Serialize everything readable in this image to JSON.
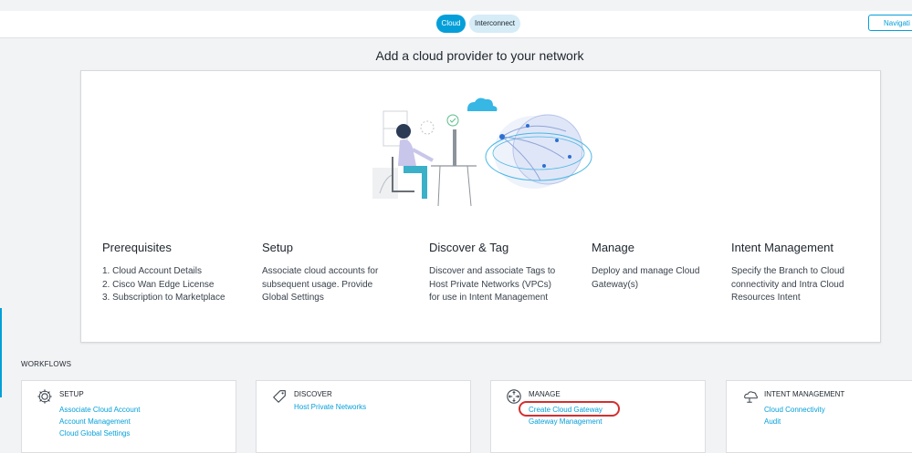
{
  "topbar": {
    "tabs": [
      {
        "label": "Cloud",
        "active": true
      },
      {
        "label": "Interconnect",
        "active": false
      }
    ],
    "nav_button_label": "Navigati"
  },
  "hero": {
    "title": "Add a cloud provider to your network",
    "columns": [
      {
        "title": "Prerequisites",
        "lines": [
          "1. Cloud Account Details",
          "2. Cisco Wan Edge License",
          "3. Subscription to Marketplace"
        ]
      },
      {
        "title": "Setup",
        "lines": [
          "Associate cloud accounts for",
          "subsequent usage. Provide",
          "Global Settings"
        ]
      },
      {
        "title": "Discover & Tag",
        "lines": [
          "Discover and associate Tags to",
          "Host Private Networks (VPCs)",
          "for use in Intent Management"
        ]
      },
      {
        "title": "Manage",
        "lines": [
          "Deploy and manage Cloud",
          "Gateway(s)"
        ]
      },
      {
        "title": "Intent Management",
        "lines": [
          "Specify the Branch to Cloud",
          "connectivity and Intra Cloud",
          "Resources Intent"
        ]
      }
    ]
  },
  "workflows": {
    "label": "WORKFLOWS",
    "cards": [
      {
        "title": "SETUP",
        "icon": "gear-icon",
        "links": [
          "Associate Cloud Account",
          "Account Management",
          "Cloud Global Settings"
        ]
      },
      {
        "title": "DISCOVER",
        "icon": "tag-icon",
        "links": [
          "Host Private Networks"
        ]
      },
      {
        "title": "MANAGE",
        "icon": "router-icon",
        "links": [
          "Create Cloud Gateway",
          "Gateway Management"
        ]
      },
      {
        "title": "INTENT MANAGEMENT",
        "icon": "cloud-network-icon",
        "links": [
          "Cloud Connectivity",
          "Audit"
        ]
      }
    ]
  },
  "colors": {
    "accent": "#049fd9",
    "highlight": "#d32f2f",
    "background": "#f2f3f5"
  }
}
